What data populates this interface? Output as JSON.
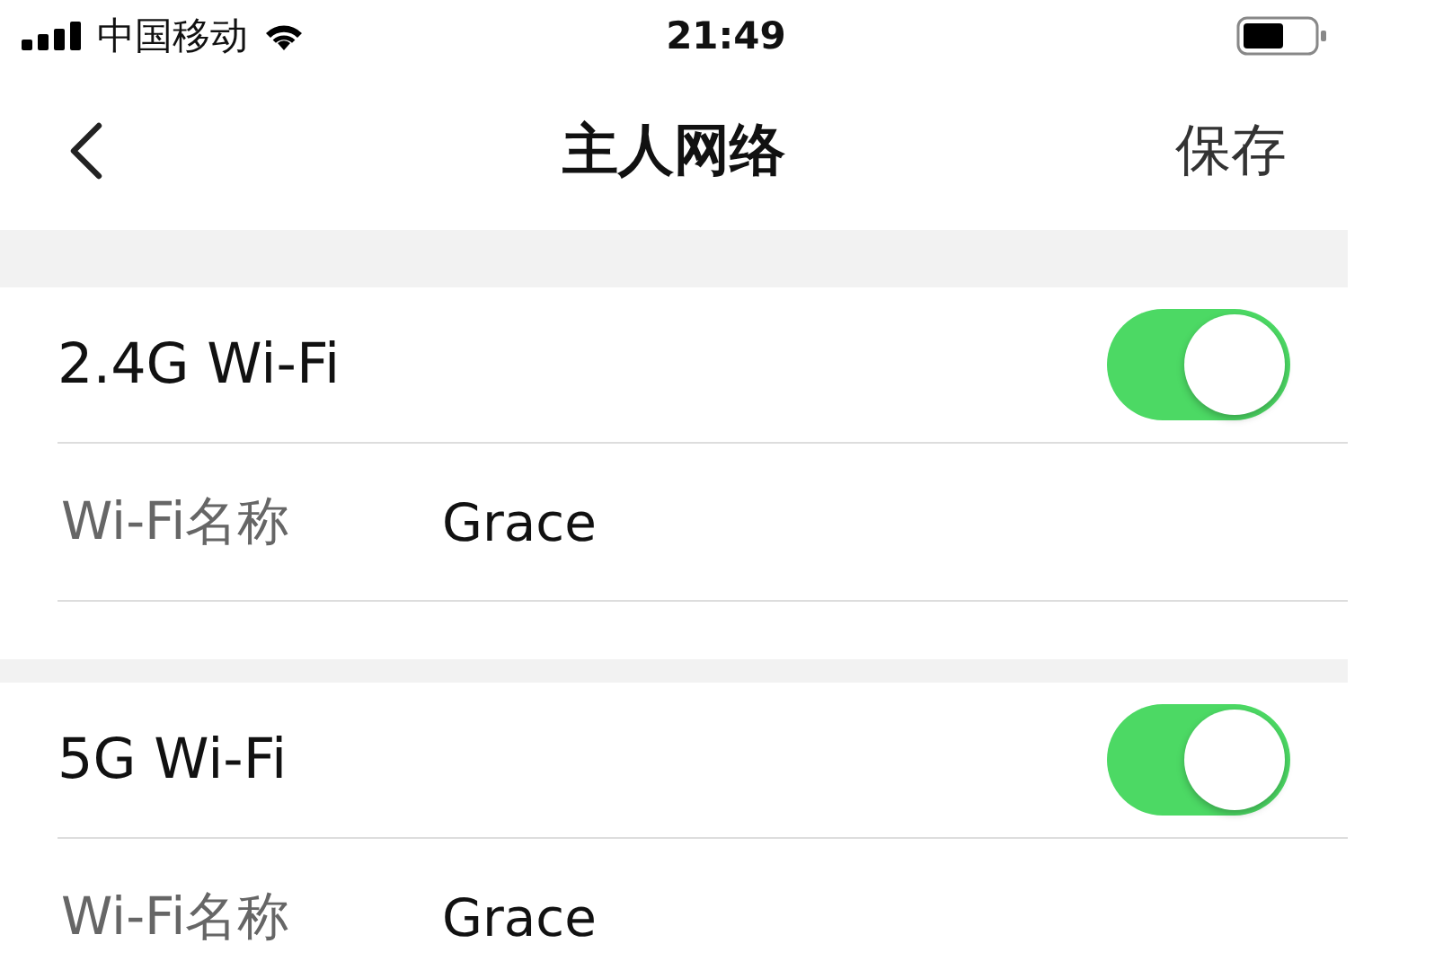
{
  "status_bar": {
    "carrier": "中国移动",
    "time": "21:49"
  },
  "nav": {
    "title": "主人网络",
    "action": "保存"
  },
  "sections": [
    {
      "title": "2.4G Wi-Fi",
      "on": true,
      "fields": [
        {
          "label": "Wi-Fi名称",
          "value": "Grace"
        }
      ]
    },
    {
      "title": "5G Wi-Fi",
      "on": true,
      "fields": [
        {
          "label": "Wi-Fi名称",
          "value": "Grace"
        }
      ]
    }
  ]
}
